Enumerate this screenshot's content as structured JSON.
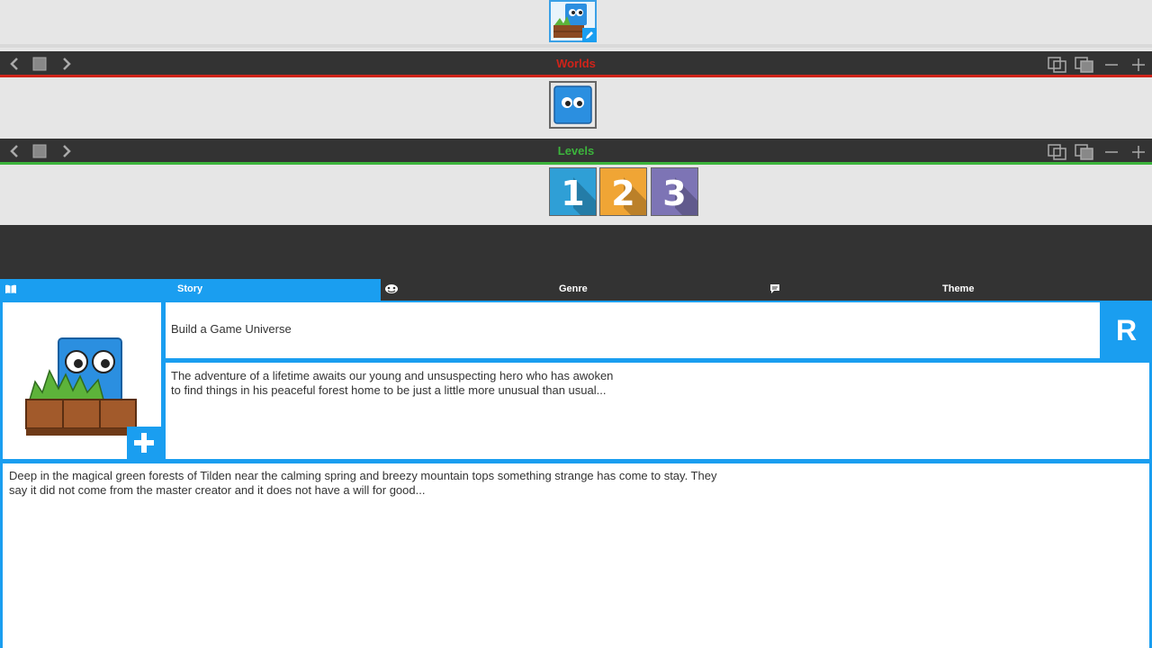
{
  "worlds_bar": {
    "title": "Worlds",
    "accent_color": "#d0231a"
  },
  "levels_bar": {
    "title": "Levels",
    "accent_color": "#3cb43c"
  },
  "levels": [
    {
      "label": "1",
      "color": "#2f9fd6"
    },
    {
      "label": "2",
      "color": "#f0a535"
    },
    {
      "label": "3",
      "color": "#7d74b5"
    }
  ],
  "tabs": [
    {
      "label": "Story",
      "icon": "book-icon",
      "active": true
    },
    {
      "label": "Genre",
      "icon": "masks-icon",
      "active": false
    },
    {
      "label": "Theme",
      "icon": "speech-bubble-icon",
      "active": false
    }
  ],
  "editor": {
    "title": "Build a Game Universe",
    "summary": "The adventure of a lifetime awaits our young and unsuspecting hero who has awoken\nto find things in his peaceful forest home to be just a little more unusual than usual...",
    "story": "Deep in the magical green forests of Tilden near the calming spring and breezy mountain tops something strange has come to stay. They\nsay it did not come from the master creator and it does not have a will for good...",
    "r_button": "R"
  },
  "colors": {
    "accent": "#1a9ef0",
    "bar": "#333333",
    "panel": "#e6e6e6"
  }
}
